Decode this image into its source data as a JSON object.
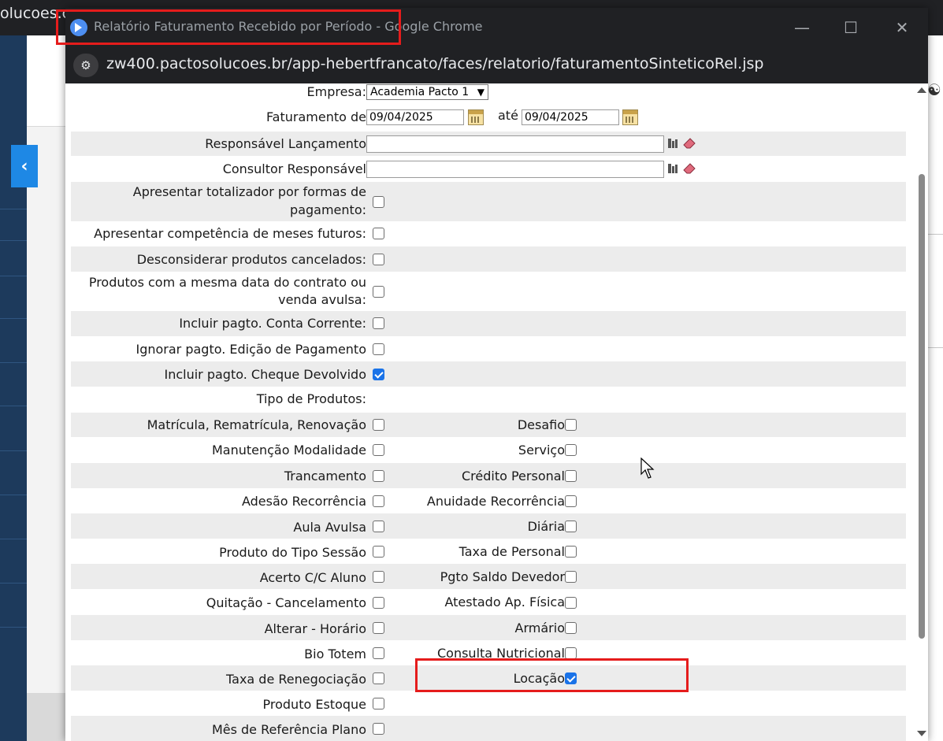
{
  "background": {
    "tab_text": "olucoes.c"
  },
  "window": {
    "title": "Relatório Faturamento Recebido por Período - Google Chrome",
    "url": "zw400.pactosolucoes.br/app-hebertfrancato/faces/relatorio/faturamentoSinteticoRel.jsp"
  },
  "form": {
    "empresa_label": "Empresa:",
    "empresa_value": "Academia Pacto 1",
    "faturamento_label": "Faturamento de",
    "date_from": "09/04/2025",
    "ate_label": "até",
    "date_to": "09/04/2025",
    "responsavel_label": "Responsável Lançamento",
    "consultor_label": "Consultor Responsável",
    "options": [
      {
        "label_1": "Apresentar totalizador por formas de",
        "label_2": "pagamento:",
        "checked": false
      },
      {
        "label": "Apresentar competência de meses futuros:",
        "checked": false
      },
      {
        "label": "Desconsiderar produtos cancelados:",
        "checked": false
      },
      {
        "label_1": "Produtos com a mesma data do contrato ou",
        "label_2": "venda avulsa:",
        "checked": false
      },
      {
        "label": "Incluir pagto. Conta Corrente:",
        "checked": false
      },
      {
        "label": "Ignorar pagto. Edição de Pagamento",
        "checked": false
      },
      {
        "label": "Incluir pagto. Cheque Devolvido",
        "checked": true
      }
    ],
    "tipo_produtos_label": "Tipo de Produtos:",
    "products": [
      {
        "left": "Matrícula, Rematrícula, Renovação",
        "left_checked": false,
        "right": "Desafio",
        "right_checked": false
      },
      {
        "left": "Manutenção Modalidade",
        "left_checked": false,
        "right": "Serviço",
        "right_checked": false
      },
      {
        "left": "Trancamento",
        "left_checked": false,
        "right": "Crédito Personal",
        "right_checked": false
      },
      {
        "left": "Adesão Recorrência",
        "left_checked": false,
        "right": "Anuidade Recorrência",
        "right_checked": false
      },
      {
        "left": "Aula Avulsa",
        "left_checked": false,
        "right": "Diária",
        "right_checked": false
      },
      {
        "left": "Produto do Tipo Sessão",
        "left_checked": false,
        "right": "Taxa de Personal",
        "right_checked": false
      },
      {
        "left": "Acerto C/C Aluno",
        "left_checked": false,
        "right": "Pgto Saldo Devedor",
        "right_checked": false
      },
      {
        "left": "Quitação - Cancelamento",
        "left_checked": false,
        "right": "Atestado Ap. Física",
        "right_checked": false
      },
      {
        "left": "Alterar - Horário",
        "left_checked": false,
        "right": "Armário",
        "right_checked": false
      },
      {
        "left": "Bio Totem",
        "left_checked": false,
        "right": "Consulta Nutricional",
        "right_checked": false
      },
      {
        "left": "Taxa de Renegociação",
        "left_checked": false,
        "right": "Locação",
        "right_checked": true
      },
      {
        "left": "Produto Estoque",
        "left_checked": false
      },
      {
        "left": "Mês de Referência Plano",
        "left_checked": false
      }
    ]
  },
  "colors": {
    "highlight": "#e51c1c",
    "checkbox_checked": "#1a73e8",
    "titlebar": "#202124"
  }
}
